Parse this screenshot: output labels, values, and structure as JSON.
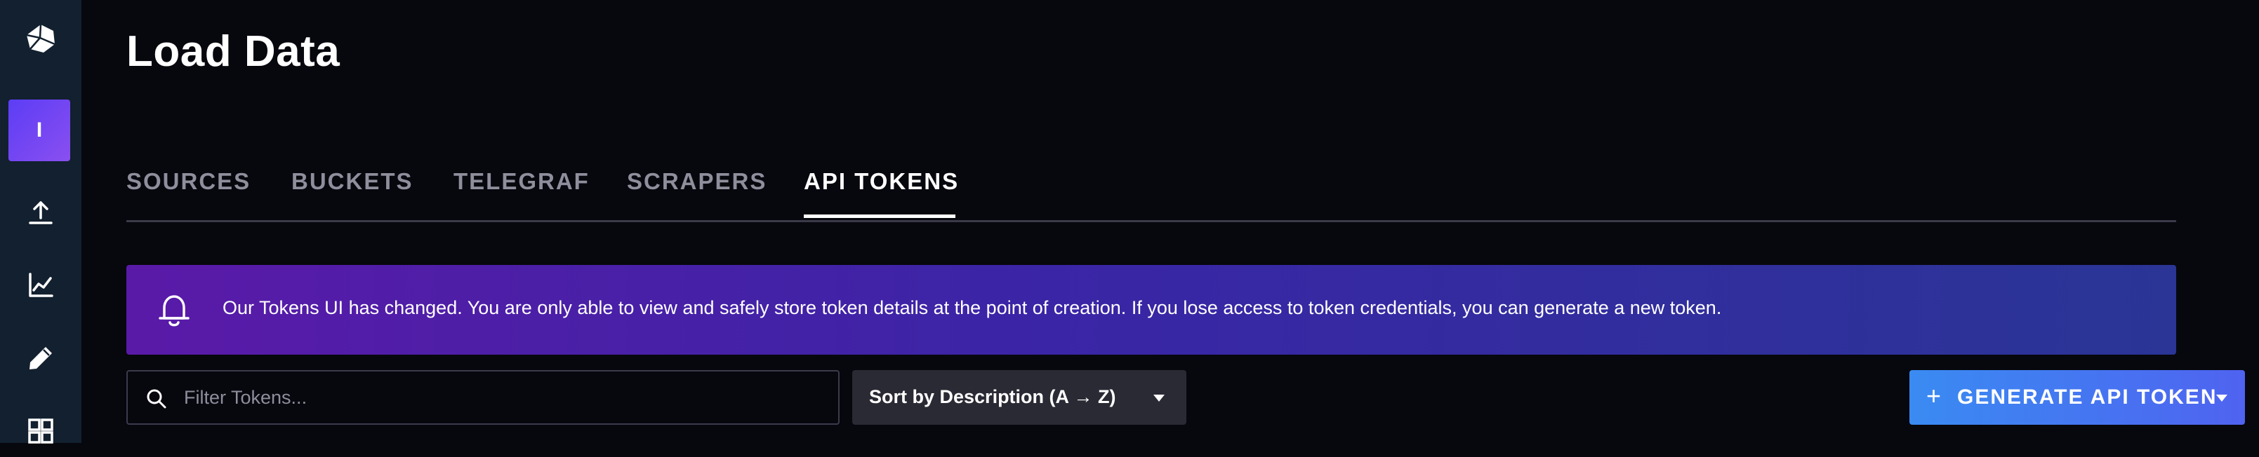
{
  "sidebar": {
    "logo_icon": "influx-cube-icon",
    "org_initial": "I",
    "org_gradient": [
      "#5c3df5",
      "#8a4ff0"
    ],
    "items": [
      {
        "icon": "upload-icon"
      },
      {
        "icon": "line-chart-icon"
      },
      {
        "icon": "pencil-icon"
      },
      {
        "icon": "dashboard-grid-icon"
      }
    ]
  },
  "header": {
    "title": "Load Data"
  },
  "tabs": [
    {
      "label": "SOURCES",
      "active": false
    },
    {
      "label": "BUCKETS",
      "active": false
    },
    {
      "label": "TELEGRAF",
      "active": false
    },
    {
      "label": "SCRAPERS",
      "active": false
    },
    {
      "label": "API TOKENS",
      "active": true
    }
  ],
  "banner": {
    "icon": "bell-icon",
    "text": "Our Tokens UI has changed. You are only able to view and safely store token details at the point of creation. If you lose access to token credentials, you can generate a new token."
  },
  "toolbar": {
    "search_placeholder": "Filter Tokens...",
    "search_value": "",
    "sort_label": "Sort by Description (A → Z)",
    "generate_plus": "+",
    "generate_label": "GENERATE API TOKEN"
  },
  "colors": {
    "background": "#07070e",
    "sidebar": "#12202f",
    "accent_button": "#4f63f0",
    "banner_start": "#5a1aa8",
    "banner_end": "#2a3596"
  }
}
